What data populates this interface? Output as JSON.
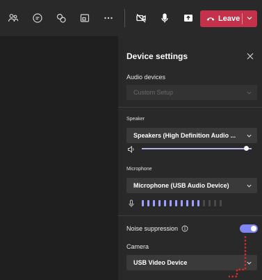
{
  "toolbar": {
    "icons": [
      "participants-icon",
      "chat-icon",
      "reactions-icon",
      "rooms-icon",
      "more-icon",
      "camera-off-icon",
      "microphone-icon",
      "share-icon"
    ],
    "leave_label": "Leave"
  },
  "panel": {
    "title": "Device settings",
    "audio_devices_label": "Audio devices",
    "audio_devices_value": "Custom Setup",
    "speaker_label": "Speaker",
    "speaker_value": "Speakers (High Definition Audio ...",
    "speaker_volume": 0.95,
    "microphone_label": "Microphone",
    "microphone_value": "Microphone (USB Audio Device)",
    "mic_level_bars_on": 11,
    "mic_level_bars_total": 15,
    "noise_suppression_label": "Noise suppression",
    "noise_suppression_on": true,
    "camera_label": "Camera",
    "camera_value": "USB Video Device"
  },
  "colors": {
    "accent": "#7f85f5",
    "leave": "#c4314b",
    "annotation": "#d92b2b"
  }
}
